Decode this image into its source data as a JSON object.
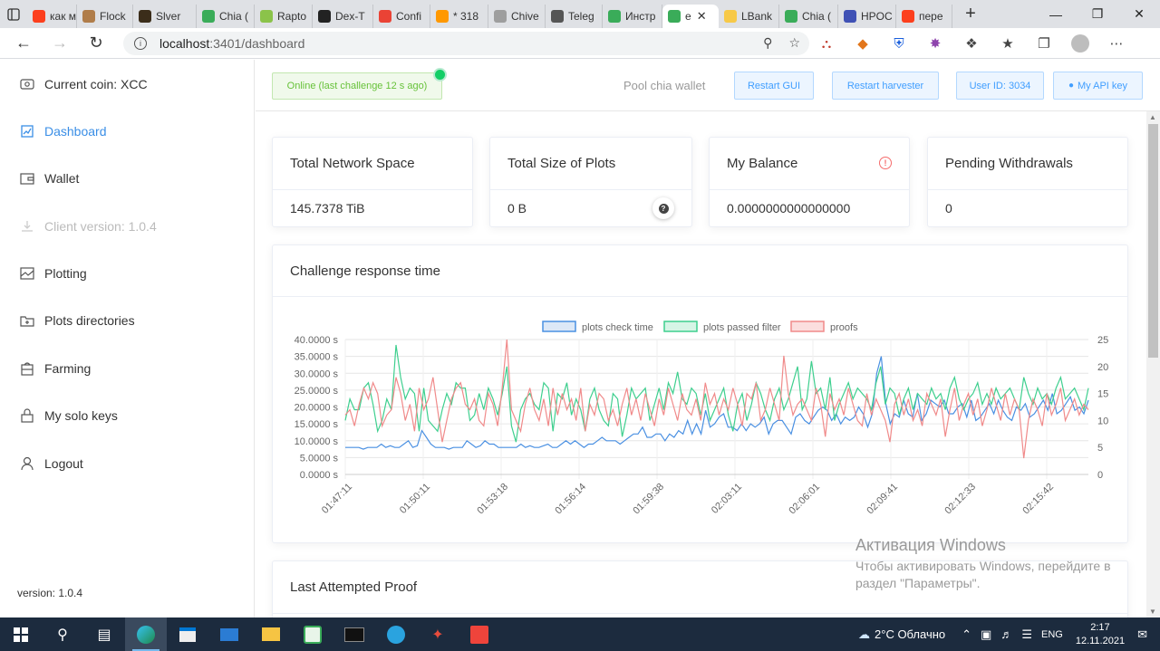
{
  "browser": {
    "tabs": [
      {
        "label": "как м",
        "color": "#fc3f1d"
      },
      {
        "label": "Flock",
        "color": "#b07d4a"
      },
      {
        "label": "Slver",
        "color": "#3b2d1a"
      },
      {
        "label": "Chia (",
        "color": "#3aac59"
      },
      {
        "label": "Rapto",
        "color": "#8bc34a"
      },
      {
        "label": "Dex-T",
        "color": "#222222"
      },
      {
        "label": "Confi",
        "color": "#ea4335"
      },
      {
        "label": "* 318",
        "color": "#ff9800"
      },
      {
        "label": "Chive",
        "color": "#9e9e9e"
      },
      {
        "label": "Teleg",
        "color": "#555555"
      },
      {
        "label": "Инстр",
        "color": "#3aac59"
      },
      {
        "label": "e",
        "color": "#3aac59",
        "active": true
      },
      {
        "label": "LBank",
        "color": "#f7c948"
      },
      {
        "label": "Chia (",
        "color": "#3aac59"
      },
      {
        "label": "HPOC",
        "color": "#3f51b5"
      },
      {
        "label": "пере",
        "color": "#fc3f1d"
      }
    ],
    "url_host": "localhost",
    "url_path": ":3401/dashboard"
  },
  "sidebar": {
    "items": [
      {
        "label": "Current coin: XCC",
        "icon": "coin-icon",
        "state": "normal"
      },
      {
        "label": "Dashboard",
        "icon": "chart-icon",
        "state": "active"
      },
      {
        "label": "Wallet",
        "icon": "wallet-icon",
        "state": "normal"
      },
      {
        "label": "Client version: 1.0.4",
        "icon": "download-icon",
        "state": "disabled"
      },
      {
        "label": "Plotting",
        "icon": "plotting-icon",
        "state": "normal"
      },
      {
        "label": "Plots directories",
        "icon": "folder-icon",
        "state": "normal"
      },
      {
        "label": "Farming",
        "icon": "farming-icon",
        "state": "normal"
      },
      {
        "label": "My solo keys",
        "icon": "lock-icon",
        "state": "normal"
      },
      {
        "label": "Logout",
        "icon": "user-icon",
        "state": "normal"
      }
    ],
    "version": "version: 1.0.4"
  },
  "header": {
    "status": "Online (last challenge 12 s ago)",
    "pool_label": "Pool chia wallet",
    "restart_gui": "Restart GUI",
    "restart_harvester": "Restart harvester",
    "user_id": "User ID: 3034",
    "api_key": "My API key"
  },
  "stats": [
    {
      "title": "Total Network Space",
      "value": "145.7378 TiB"
    },
    {
      "title": "Total Size of Plots",
      "value": "0 B"
    },
    {
      "title": "My Balance",
      "value": "0.0000000000000000"
    },
    {
      "title": "Pending Withdrawals",
      "value": "0"
    }
  ],
  "chart_title": "Challenge response time",
  "last_proof_title": "Last Attempted Proof",
  "chart_data": {
    "type": "line",
    "x_ticks": [
      "01:47:11",
      "01:50:11",
      "01:53:18",
      "01:56:14",
      "01:59:38",
      "02:03:11",
      "02:06:01",
      "02:09:41",
      "02:12:33",
      "02:15:42"
    ],
    "y_left_ticks": [
      "0.0000 s",
      "5.0000 s",
      "10.0000 s",
      "15.0000 s",
      "20.0000 s",
      "25.0000 s",
      "30.0000 s",
      "35.0000 s",
      "40.0000 s"
    ],
    "y_right_ticks": [
      "0",
      "5",
      "10",
      "15",
      "20",
      "25"
    ],
    "ylim_left": [
      0,
      40
    ],
    "ylim_right": [
      0,
      25
    ],
    "legend_position": "top",
    "grid": true,
    "series": [
      {
        "name": "plots check time",
        "axis": "left",
        "border": "#4a90e2",
        "fill": "#dce8f7",
        "values": [
          8,
          8,
          8,
          8,
          7.5,
          8,
          8,
          8,
          9,
          8,
          8.5,
          8,
          8,
          9,
          10,
          8,
          8.5,
          13,
          11,
          9,
          8,
          8,
          8,
          7.5,
          8,
          8,
          8,
          10,
          9,
          8,
          8.5,
          10,
          9,
          9,
          8,
          8,
          8,
          8,
          8,
          9,
          8,
          8.5,
          8,
          8,
          8.5,
          9,
          8,
          8,
          9,
          10,
          9,
          10,
          9,
          8,
          9,
          9,
          10,
          11,
          10,
          10,
          10,
          9,
          10,
          11,
          12,
          12,
          14,
          11,
          11,
          12,
          12,
          10,
          12,
          11,
          13,
          12,
          16,
          12,
          15,
          12,
          19,
          14,
          15,
          17,
          18,
          14,
          14,
          13,
          15,
          13,
          15,
          14,
          15,
          17,
          12,
          15,
          16,
          16,
          14,
          12,
          17,
          18,
          16,
          15,
          17,
          19,
          20,
          19,
          16,
          18,
          15,
          17,
          16,
          17,
          20,
          18,
          14,
          18,
          30,
          35,
          21,
          15,
          18,
          17,
          22,
          18,
          17,
          24,
          16,
          18,
          22,
          21,
          20,
          22,
          18,
          18,
          20,
          21,
          17,
          22,
          16,
          17,
          19,
          21,
          18,
          22,
          19,
          17,
          16,
          20,
          19,
          21,
          17,
          18,
          20,
          22,
          19,
          24,
          18,
          19,
          21,
          23,
          19,
          20,
          18,
          22
        ]
      },
      {
        "name": "plots passed filter",
        "axis": "right",
        "border": "#3ecf8e",
        "fill": "#d6f5e6",
        "values": [
          10,
          14,
          12,
          12,
          16,
          17,
          13,
          8,
          10,
          14,
          12,
          24,
          18,
          14,
          16,
          15,
          8,
          16,
          10,
          9,
          8,
          12,
          15,
          13,
          17,
          16,
          16,
          10,
          11,
          15,
          12,
          16,
          14,
          11,
          15,
          20,
          9,
          6,
          12,
          14,
          15,
          13,
          12,
          17,
          16,
          8,
          15,
          14,
          17,
          11,
          14,
          12,
          8,
          14,
          16,
          12,
          10,
          9,
          15,
          14,
          7,
          11,
          16,
          14,
          15,
          16,
          10,
          13,
          16,
          12,
          17,
          15,
          19,
          14,
          13,
          16,
          15,
          11,
          15,
          10,
          12,
          14,
          16,
          11,
          8,
          13,
          15,
          10,
          13,
          17,
          15,
          12,
          10,
          14,
          16,
          12,
          14,
          17,
          20,
          12,
          14,
          21,
          15,
          16,
          12,
          18,
          10,
          13,
          15,
          17,
          14,
          16,
          15,
          14,
          12,
          17,
          20,
          13,
          16,
          15,
          11,
          14,
          16,
          12,
          15,
          14,
          13,
          16,
          14,
          15,
          12,
          16,
          18,
          14,
          12,
          14,
          15,
          17,
          13,
          15,
          13,
          16,
          14,
          15,
          16,
          14,
          12,
          18,
          15,
          13,
          16,
          14,
          15,
          13,
          16,
          18,
          14,
          15,
          16,
          14,
          12,
          16
        ]
      },
      {
        "name": "proofs",
        "axis": "right",
        "border": "#f08a8a",
        "fill": "#fbdede",
        "values": [
          11,
          12,
          9,
          13,
          16,
          14,
          17,
          15,
          9,
          11,
          12,
          18,
          15,
          10,
          13,
          8,
          16,
          12,
          14,
          18,
          12,
          6,
          10,
          14,
          16,
          17,
          13,
          12,
          14,
          10,
          9,
          15,
          13,
          9,
          16,
          25,
          12,
          10,
          8,
          13,
          16,
          12,
          10,
          14,
          9,
          16,
          11,
          15,
          12,
          14,
          10,
          16,
          8,
          13,
          11,
          15,
          14,
          10,
          12,
          9,
          13,
          16,
          11,
          14,
          10,
          15,
          12,
          9,
          14,
          11,
          16,
          13,
          10,
          15,
          12,
          11,
          14,
          10,
          17,
          13,
          15,
          11,
          14,
          12,
          16,
          13,
          9,
          15,
          14,
          17,
          10,
          12,
          16,
          13,
          10,
          22,
          15,
          11,
          13,
          14,
          12,
          10,
          16,
          13,
          7,
          15,
          12,
          14,
          11,
          16,
          13,
          10,
          9,
          15,
          11,
          14,
          12,
          10,
          6,
          13,
          15,
          11,
          14,
          10,
          12,
          9,
          15,
          13,
          11,
          14,
          7,
          12,
          16,
          10,
          13,
          15,
          11,
          14,
          9,
          12,
          16,
          13,
          10,
          15,
          11,
          14,
          12,
          3,
          10,
          14,
          12,
          9,
          15,
          11,
          13,
          16,
          10,
          12,
          14,
          11,
          13,
          12
        ]
      }
    ]
  }
}
